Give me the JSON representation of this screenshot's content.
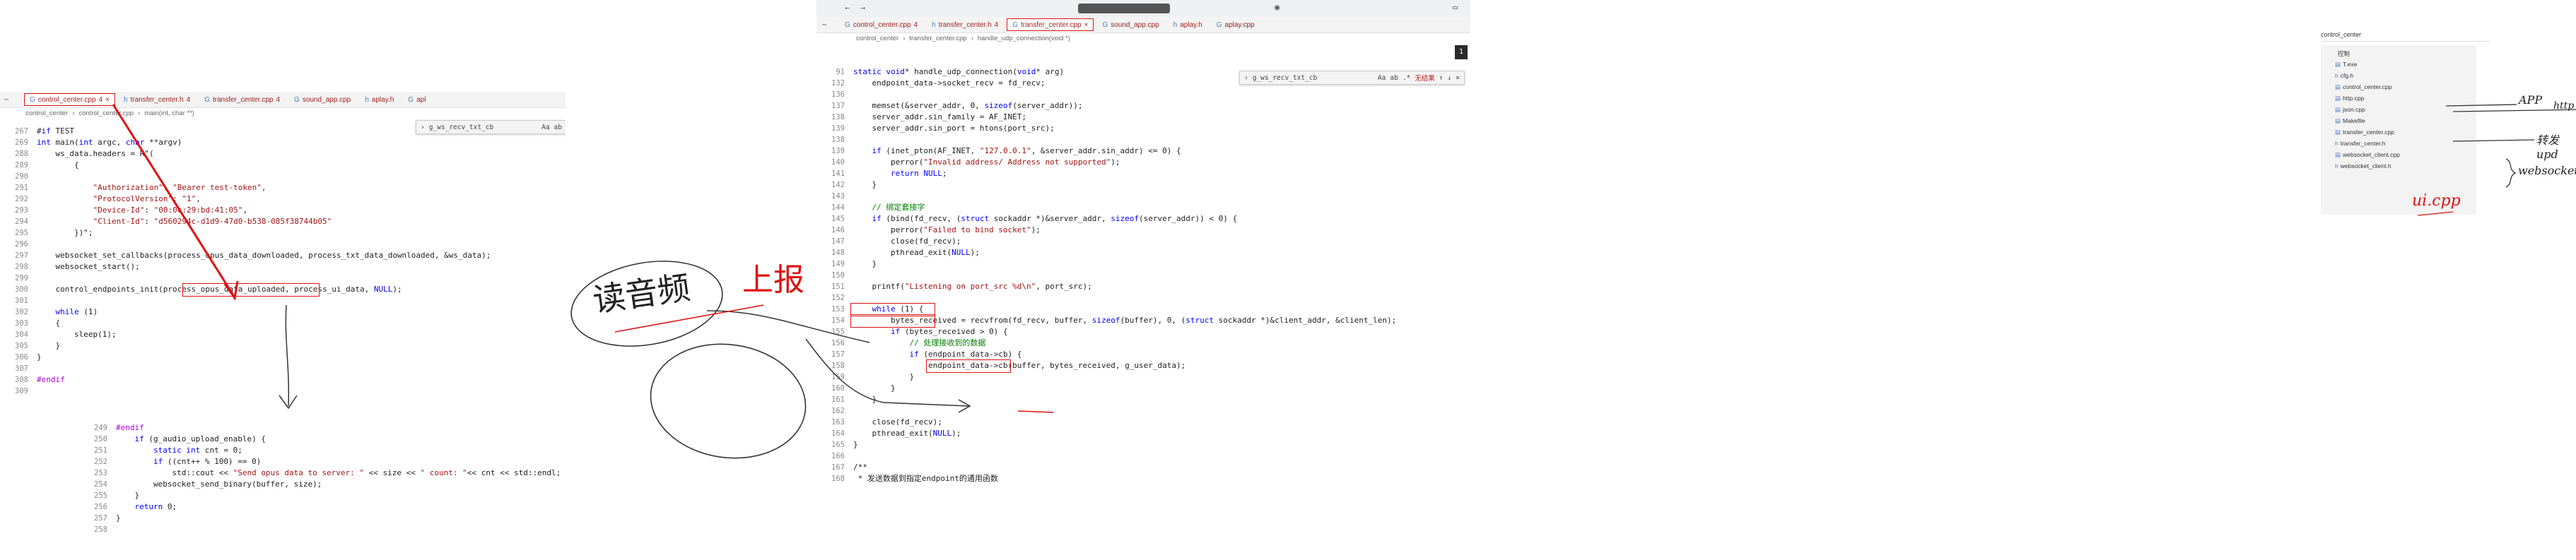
{
  "left_editor": {
    "tabs": [
      {
        "label": "control_center.cpp",
        "count": "4",
        "boxed": true
      },
      {
        "label": "transfer_center.h",
        "count": "4",
        "boxed": false
      },
      {
        "label": "transfer_center.cpp",
        "count": "4",
        "boxed": false
      },
      {
        "label": "sound_app.cpp",
        "count": "",
        "boxed": false
      },
      {
        "label": "aplay.h",
        "count": "",
        "boxed": false
      },
      {
        "label": "apl",
        "count": "",
        "boxed": false
      }
    ],
    "breadcrumb": [
      "control_center",
      "control_center.cpp",
      "main(int, char **)"
    ],
    "find_text": "g_ws_recv_txt_cb",
    "lines": [
      {
        "n": "267",
        "code": "#if TEST"
      },
      {
        "n": "269",
        "code": "int main(int argc, char **argv)"
      },
      {
        "n": "288",
        "code": "    ws_data.headers = R\"("
      },
      {
        "n": "289",
        "code": "        {"
      },
      {
        "n": "290",
        "code": ""
      },
      {
        "n": "291",
        "code": "            \"Authorization\": \"Bearer test-token\","
      },
      {
        "n": "292",
        "code": "            \"ProtocolVersion\": \"1\","
      },
      {
        "n": "293",
        "code": "            \"Device-Id\": \"00:0c:29:bd:41:05\","
      },
      {
        "n": "294",
        "code": "            \"Client-Id\": \"d560294c-d1d9-47d0-b538-085f38744b05\""
      },
      {
        "n": "295",
        "code": "        })\";"
      },
      {
        "n": "296",
        "code": ""
      },
      {
        "n": "297",
        "code": "    websocket_set_callbacks(process_opus_data_downloaded, process_txt_data_downloaded, &ws_data);"
      },
      {
        "n": "298",
        "code": "    websocket_start();"
      },
      {
        "n": "299",
        "code": ""
      },
      {
        "n": "300",
        "code": "    control_endpoints_init(process_opus_data_uploaded, process_ui_data, NULL);"
      },
      {
        "n": "301",
        "code": ""
      },
      {
        "n": "302",
        "code": "    while (1)"
      },
      {
        "n": "303",
        "code": "    {"
      },
      {
        "n": "304",
        "code": "        sleep(1);"
      },
      {
        "n": "305",
        "code": "    }"
      },
      {
        "n": "306",
        "code": "}"
      },
      {
        "n": "307",
        "code": ""
      },
      {
        "n": "308",
        "code": "#endif"
      },
      {
        "n": "309",
        "code": ""
      }
    ]
  },
  "snippet": {
    "lines": [
      {
        "n": "249",
        "code": "#endif"
      },
      {
        "n": "250",
        "code": "    if (g_audio_upload_enable) {"
      },
      {
        "n": "251",
        "code": "        static int cnt = 0;"
      },
      {
        "n": "252",
        "code": "        if ((cnt++ % 100) == 0)"
      },
      {
        "n": "253",
        "code": "            std::cout << \"Send opus data to server: \" << size << \" count: \"<< cnt << std::endl;"
      },
      {
        "n": "254",
        "code": "        websocket_send_binary(buffer, size);"
      },
      {
        "n": "255",
        "code": "    }"
      },
      {
        "n": "256",
        "code": "    return 0;"
      },
      {
        "n": "257",
        "code": "}"
      },
      {
        "n": "258",
        "code": ""
      }
    ]
  },
  "right_editor": {
    "tabs": [
      {
        "label": "control_center.cpp",
        "count": "4",
        "boxed": false
      },
      {
        "label": "transfer_center.h",
        "count": "4",
        "boxed": false
      },
      {
        "label": "transfer_center.cpp",
        "count": "",
        "boxed": true
      },
      {
        "label": "sound_app.cpp",
        "count": "",
        "boxed": false
      },
      {
        "label": "aplay.h",
        "count": "",
        "boxed": false
      },
      {
        "label": "aplay.cpp",
        "count": "",
        "boxed": false
      }
    ],
    "breadcrumb": [
      "control_center",
      "transfer_center.cpp",
      "handle_udp_connection(void *)"
    ],
    "find_text": "g_ws_recv_txt_cb",
    "no_results": "无结果",
    "lines": [
      {
        "n": "91",
        "code": "static void* handle_udp_connection(void* arg)"
      },
      {
        "n": "132",
        "code": "    endpoint_data->socket_recv = fd_recv;"
      },
      {
        "n": "136",
        "code": ""
      },
      {
        "n": "137",
        "code": "    memset(&server_addr, 0, sizeof(server_addr));"
      },
      {
        "n": "138",
        "code": "    server_addr.sin_family = AF_INET;"
      },
      {
        "n": "139",
        "code": "    server_addr.sin_port = htons(port_src);"
      },
      {
        "n": "138",
        "code": ""
      },
      {
        "n": "139",
        "code": "    if (inet_pton(AF_INET, \"127.0.0.1\", &server_addr.sin_addr) <= 0) {"
      },
      {
        "n": "140",
        "code": "        perror(\"Invalid address/ Address not supported\");"
      },
      {
        "n": "141",
        "code": "        return NULL;"
      },
      {
        "n": "142",
        "code": "    }"
      },
      {
        "n": "143",
        "code": ""
      },
      {
        "n": "144",
        "code": "    // 绑定套接字"
      },
      {
        "n": "145",
        "code": "    if (bind(fd_recv, (struct sockaddr *)&server_addr, sizeof(server_addr)) < 0) {"
      },
      {
        "n": "146",
        "code": "        perror(\"Failed to bind socket\");"
      },
      {
        "n": "147",
        "code": "        close(fd_recv);"
      },
      {
        "n": "148",
        "code": "        pthread_exit(NULL);"
      },
      {
        "n": "149",
        "code": "    }"
      },
      {
        "n": "150",
        "code": ""
      },
      {
        "n": "151",
        "code": "    printf(\"Listening on port_src %d\\n\", port_src);"
      },
      {
        "n": "152",
        "code": ""
      },
      {
        "n": "153",
        "code": "    while (1) {"
      },
      {
        "n": "154",
        "code": "        bytes_received = recvfrom(fd_recv, buffer, sizeof(buffer), 0, (struct sockaddr *)&client_addr, &client_len);"
      },
      {
        "n": "155",
        "code": "        if (bytes_received > 0) {"
      },
      {
        "n": "156",
        "code": "            // 处理接收到的数据"
      },
      {
        "n": "157",
        "code": "            if (endpoint_data->cb) {"
      },
      {
        "n": "158",
        "code": "                endpoint_data->cb(buffer, bytes_received, g_user_data);"
      },
      {
        "n": "159",
        "code": "            }"
      },
      {
        "n": "160",
        "code": "        }"
      },
      {
        "n": "161",
        "code": "    }"
      },
      {
        "n": "162",
        "code": ""
      },
      {
        "n": "163",
        "code": "    close(fd_recv);"
      },
      {
        "n": "164",
        "code": "    pthread_exit(NULL);"
      },
      {
        "n": "165",
        "code": "}"
      },
      {
        "n": "166",
        "code": ""
      },
      {
        "n": "167",
        "code": "/**"
      },
      {
        "n": "168",
        "code": " * 发送数据到指定endpoint的通用函数"
      }
    ]
  },
  "explorer": {
    "search_text": "control_center",
    "header": "控制",
    "items": [
      {
        "label": "T.exe"
      },
      {
        "label": "cfg.h"
      },
      {
        "label": "control_center.cpp"
      },
      {
        "label": "http.cpp"
      },
      {
        "label": "json.cpp"
      },
      {
        "label": "Makefile"
      },
      {
        "label": "transfer_center.cpp"
      },
      {
        "label": "transfer_center.h"
      },
      {
        "label": "websocket_client.cpp"
      },
      {
        "label": "websocket_client.h"
      }
    ]
  },
  "annotations": {
    "read_audio": "读音频",
    "report": "上报",
    "app": "APP",
    "http": "http",
    "transfer": "转发 upd",
    "websocket": "websocket",
    "ui": "ui.cpp"
  }
}
